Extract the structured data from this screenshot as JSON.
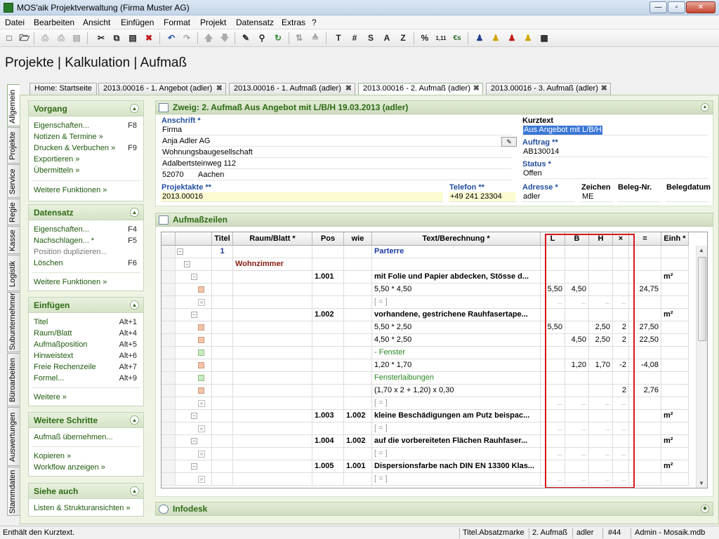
{
  "window": {
    "title": "MOS'aik Projektverwaltung (Firma Muster AG)",
    "min": "—",
    "max": "▫",
    "close": "✕"
  },
  "menu": [
    "Datei",
    "Bearbeiten",
    "Ansicht",
    "Einfügen",
    "Format",
    "Projekt",
    "Datensatz",
    "Extras",
    "?"
  ],
  "toolbar": {
    "text_buttons": [
      "T",
      "#",
      "S",
      "A",
      "Z",
      "%",
      "1,11",
      "€s"
    ]
  },
  "heading": "Projekte | Kalkulation | Aufmaß",
  "doc_tabs": [
    {
      "label": "Home: Startseite",
      "closable": false,
      "active": false
    },
    {
      "label": "2013.00016 - 1. Angebot (adler)",
      "closable": true,
      "active": false
    },
    {
      "label": "2013.00016 - 1. Aufmaß (adler)",
      "closable": true,
      "active": false
    },
    {
      "label": "2013.00016 - 2. Aufmaß (adler)",
      "closable": true,
      "active": true
    },
    {
      "label": "2013.00016 - 3. Aufmaß (adler)",
      "closable": true,
      "active": false
    }
  ],
  "vertical_tabs": [
    "Allgemein",
    "Projekte",
    "Service",
    "Regie",
    "Kasse",
    "Logistik",
    "Subunternehmer",
    "Büroarbeiten",
    "Auswertungen",
    "Stammdaten"
  ],
  "sidebar": {
    "vorgang": {
      "title": "Vorgang",
      "items": [
        {
          "label": "Eigenschaften...",
          "key": "F8"
        },
        {
          "label": "Notizen & Termine »",
          "key": ""
        },
        {
          "label": "Drucken & Verbuchen »",
          "key": "F9"
        },
        {
          "label": "Exportieren »",
          "key": ""
        },
        {
          "label": "Übermitteln »",
          "key": ""
        }
      ],
      "more": "Weitere Funktionen »"
    },
    "datensatz": {
      "title": "Datensatz",
      "items": [
        {
          "label": "Eigenschaften...",
          "key": "F4"
        },
        {
          "label": "Nachschlagen... *",
          "key": "F5"
        },
        {
          "label": "Position duplizieren...",
          "key": ""
        },
        {
          "label": "Löschen",
          "key": "F6"
        }
      ],
      "more": "Weitere Funktionen »"
    },
    "einfuegen": {
      "title": "Einfügen",
      "items": [
        {
          "label": "Titel",
          "key": "Alt+1"
        },
        {
          "label": "Raum/Blatt",
          "key": "Alt+4"
        },
        {
          "label": "Aufmaßposition",
          "key": "Alt+5"
        },
        {
          "label": "Hinweistext",
          "key": "Alt+6"
        },
        {
          "label": "Freie Rechenzeile",
          "key": "Alt+7"
        },
        {
          "label": "Formel...",
          "key": "Alt+9"
        }
      ],
      "more": "Weitere »"
    },
    "schritte": {
      "title": "Weitere Schritte",
      "items": [
        "Aufmaß übernehmen...",
        "Kopieren »",
        "Workflow anzeigen »"
      ]
    },
    "siehe": {
      "title": "Siehe auch",
      "items": [
        "Listen & Strukturansichten »"
      ]
    }
  },
  "zweig": {
    "title": "Zweig: 2. Aufmaß Aus Angebot mit L/B/H 19.03.2013 (adler)",
    "anschrift_label": "Anschrift *",
    "anschrift": [
      "Firma",
      "Anja Adler AG",
      "Wohnungsbaugesellschaft",
      "Adalbertsteinweg 112"
    ],
    "plz": "52070",
    "ort": "Aachen",
    "kurztext_label": "Kurztext",
    "kurztext": "Aus Angebot mit L/B/H",
    "auftrag_label": "Auftrag **",
    "auftrag": "AB130014",
    "status_label": "Status *",
    "status": "Offen",
    "projektakte_label": "Projektakte **",
    "projektakte": "2013.00016",
    "telefon_label": "Telefon **",
    "telefon": "+49 241 23304",
    "adresse_label": "Adresse *",
    "adresse": "adler",
    "zeichen_label": "Zeichen",
    "zeichen": "ME",
    "belegnr_label": "Beleg-Nr.",
    "belegnr": "",
    "belegdatum_label": "Belegdatum",
    "belegdatum": ""
  },
  "aufmass": {
    "title": "Aufmaßzeilen",
    "columns": [
      "Titel",
      "Raum/Blatt *",
      "Pos",
      "wie",
      "Text/Berechnung *",
      "L",
      "B",
      "H",
      "×",
      "=",
      "Einh *"
    ],
    "rows": [
      {
        "type": "titel",
        "titel": "1",
        "text": "Parterre"
      },
      {
        "type": "raum",
        "raum": "Wohnzimmer"
      },
      {
        "type": "pos",
        "pos": "1.001",
        "wie": "",
        "text": "mit Folie und Papier abdecken, Stösse d...",
        "einh": "m²"
      },
      {
        "type": "calc",
        "text": "5,50 * 4,50",
        "l": "5,50",
        "b": "4,50",
        "h": "",
        "x": "",
        "eq": "24,75"
      },
      {
        "type": "sum",
        "text": "[ = ]"
      },
      {
        "type": "pos",
        "pos": "1.002",
        "wie": "",
        "text": "vorhandene, gestrichene Rauhfasertape...",
        "einh": "m²"
      },
      {
        "type": "calc",
        "text": "5,50 * 2,50",
        "l": "5,50",
        "b": "",
        "h": "2,50",
        "x": "2",
        "eq": "27,50"
      },
      {
        "type": "calc",
        "text": "4,50 * 2,50",
        "l": "",
        "b": "4,50",
        "h": "2,50",
        "x": "2",
        "eq": "22,50"
      },
      {
        "type": "note",
        "text": "- Fenster"
      },
      {
        "type": "calc",
        "text": "1,20 * 1,70",
        "l": "",
        "b": "1,20",
        "h": "1,70",
        "x": "-2",
        "eq": "-4,08"
      },
      {
        "type": "note",
        "text": "Fensterlaibungen"
      },
      {
        "type": "calc",
        "text": "(1,70 x 2 + 1,20) x 0,30",
        "l": "",
        "b": "",
        "h": "",
        "x": "2",
        "eq": "2,76"
      },
      {
        "type": "sum",
        "text": "[ = ]"
      },
      {
        "type": "pos",
        "pos": "1.003",
        "wie": "1.002",
        "text": "kleine Beschädigungen am Putz beispac...",
        "einh": "m²"
      },
      {
        "type": "sum",
        "text": "[ = ]"
      },
      {
        "type": "pos",
        "pos": "1.004",
        "wie": "1.002",
        "text": "auf die vorbereiteten Flächen Rauhfaser...",
        "einh": "m²"
      },
      {
        "type": "sum",
        "text": "[ = ]"
      },
      {
        "type": "pos",
        "pos": "1.005",
        "wie": "1.001",
        "text": "Dispersionsfarbe nach DIN EN 13300 Klas...",
        "einh": "m²"
      },
      {
        "type": "sum",
        "text": "[ = ]"
      }
    ],
    "placeholder": "..."
  },
  "infodesk": "Infodesk",
  "status": {
    "message": "Enthält den Kurztext.",
    "cells": [
      "Titel.Absatzmarke",
      "2. Aufmaß",
      "adler",
      "#44",
      "Admin - Mosaik.mdb"
    ]
  }
}
